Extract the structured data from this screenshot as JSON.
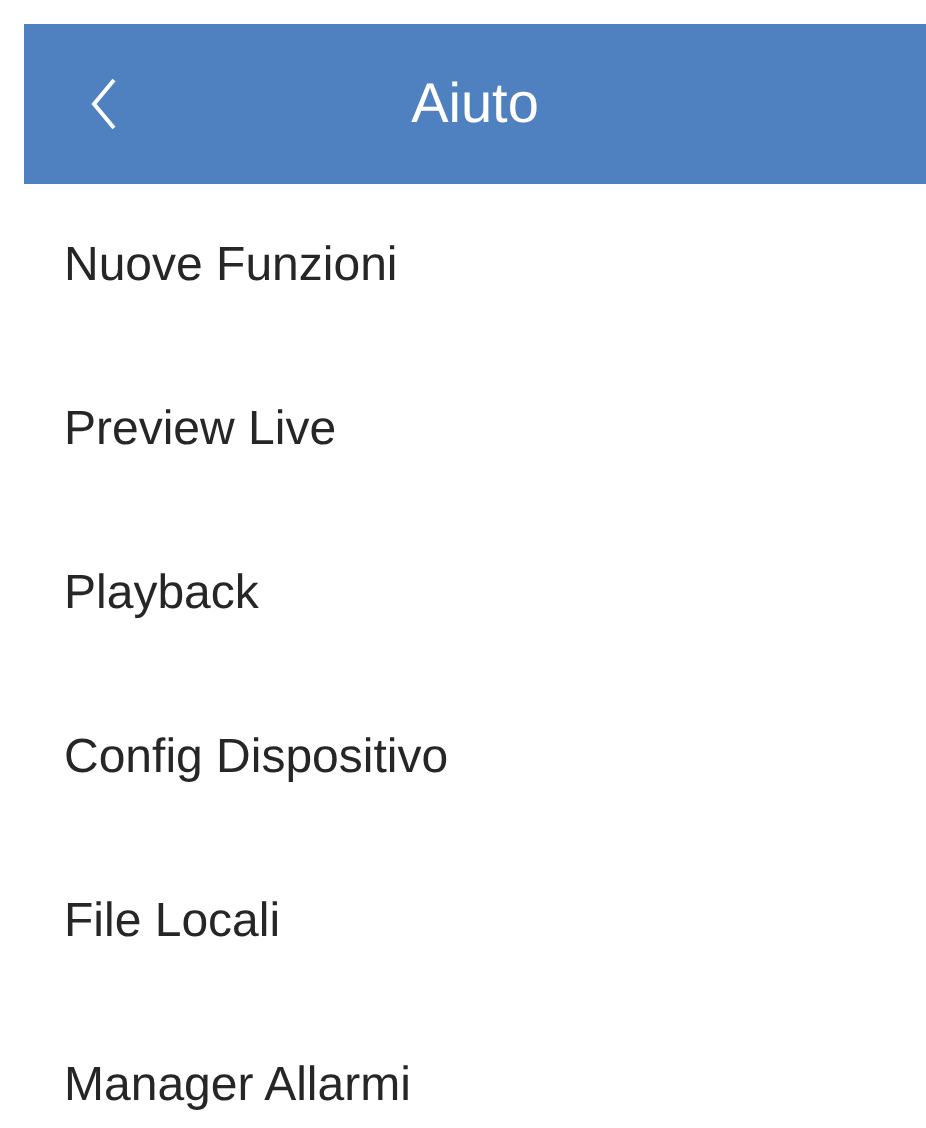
{
  "header": {
    "title": "Aiuto"
  },
  "items": [
    {
      "label": "Nuove Funzioni"
    },
    {
      "label": "Preview Live"
    },
    {
      "label": "Playback"
    },
    {
      "label": "Config Dispositivo"
    },
    {
      "label": "File Locali"
    },
    {
      "label": "Manager Allarmi"
    }
  ]
}
